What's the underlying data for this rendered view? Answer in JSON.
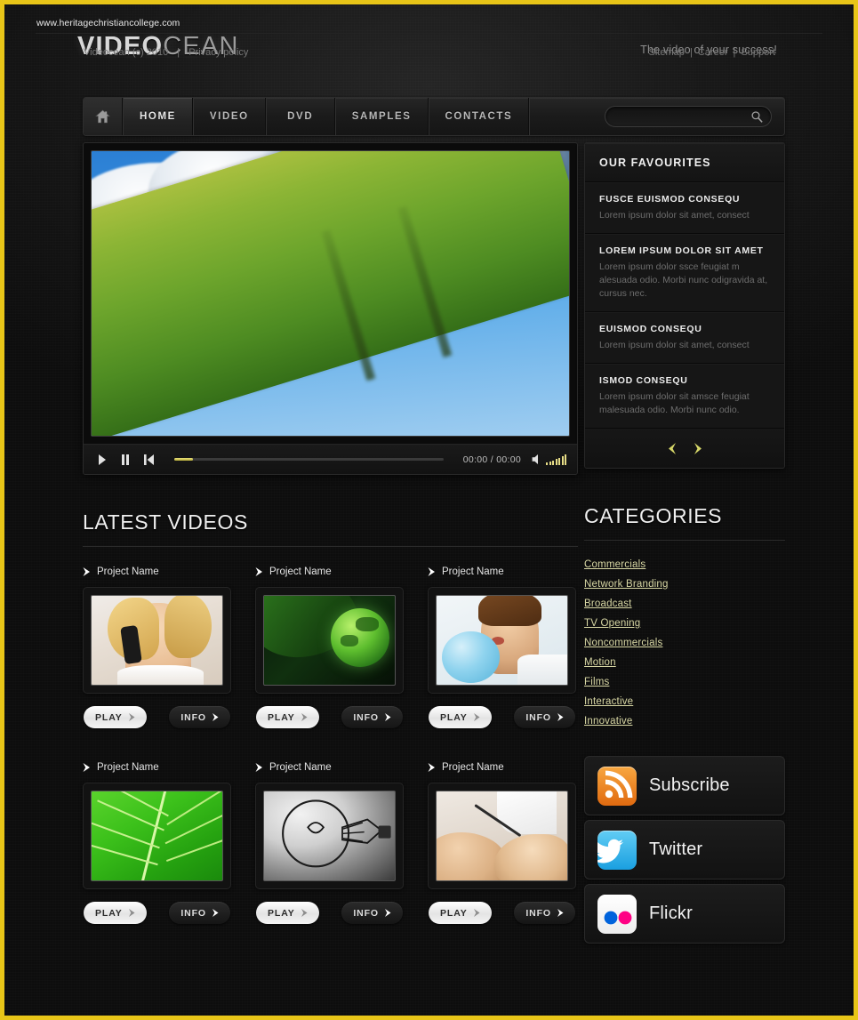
{
  "site": {
    "logo_bold": "VIDEO",
    "logo_light": "CEAN",
    "tagline": "The video of your success!",
    "accent_border": "#e8c518",
    "link_color": "#d8d7a4"
  },
  "nav": {
    "home_icon": "home-icon",
    "items": [
      {
        "label": "HOME",
        "active": true
      },
      {
        "label": "VIDEO",
        "active": false
      },
      {
        "label": "DVD",
        "active": false
      },
      {
        "label": "SAMPLES",
        "active": false
      },
      {
        "label": "CONTACTS",
        "active": false
      }
    ]
  },
  "search": {
    "value": "",
    "placeholder": "",
    "icon": "search-icon"
  },
  "player": {
    "time_display": "00:00 / 00:00",
    "progress_percent": 7,
    "buttons": [
      "play-icon",
      "pause-icon",
      "previous-icon"
    ],
    "volume_icon": "speaker-icon",
    "volume_level": 7
  },
  "favourites": {
    "title": "OUR FAVOURITES",
    "items": [
      {
        "title": "FUSCE EUISMOD CONSEQU",
        "text": "Lorem ipsum dolor sit amet, consect"
      },
      {
        "title": "LOREM IPSUM DOLOR SIT AMET",
        "text": "Lorem ipsum dolor ssce feugiat m alesuada odio. Morbi nunc odigravida at, cursus nec."
      },
      {
        "title": "EUISMOD CONSEQU",
        "text": "Lorem ipsum dolor sit amet, consect"
      },
      {
        "title": "ISMOD CONSEQU",
        "text": "Lorem ipsum dolor sit amsce feugiat malesuada odio. Morbi nunc odio."
      }
    ],
    "prev_icon": "chevron-left-icon",
    "next_icon": "chevron-right-icon"
  },
  "latest_videos": {
    "heading": "LATEST VIDEOS",
    "play_label": "PLAY",
    "info_label": "INFO",
    "items": [
      {
        "name": "Project Name",
        "thumb": "woman-on-phone"
      },
      {
        "name": "Project Name",
        "thumb": "green-globe"
      },
      {
        "name": "Project Name",
        "thumb": "woman-blue-balloon"
      },
      {
        "name": "Project Name",
        "thumb": "green-leaf"
      },
      {
        "name": "Project Name",
        "thumb": "lightbulb"
      },
      {
        "name": "Project Name",
        "thumb": "hands-writing"
      }
    ]
  },
  "categories": {
    "heading": "CATEGORIES",
    "items": [
      "Commercials",
      "Network Branding",
      "Broadcast",
      "TV Opening",
      "Noncommercials",
      "Motion",
      "Films",
      "Interactive",
      "Innovative"
    ]
  },
  "social": [
    {
      "label": "Subscribe",
      "icon": "rss-icon"
    },
    {
      "label": "Twitter",
      "icon": "twitter-icon"
    },
    {
      "label": "Flickr",
      "icon": "flickr-icon"
    }
  ],
  "footer": {
    "site_url": "www.heritagechristiancollege.com",
    "copyright": "Videocean (c) 2010",
    "separator": "|",
    "privacy": "Privacy policy",
    "links": [
      "Sitemap",
      "Career",
      "Support"
    ]
  }
}
